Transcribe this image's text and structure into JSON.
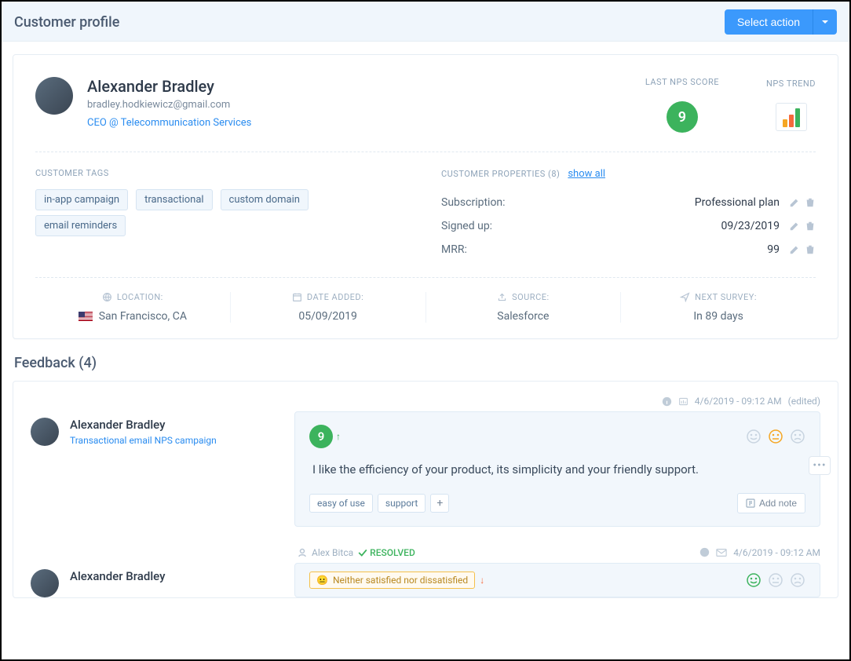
{
  "header": {
    "title": "Customer profile",
    "actionLabel": "Select action"
  },
  "profile": {
    "name": "Alexander Bradley",
    "email": "bradley.hodkiewicz@gmail.com",
    "role": "CEO @ Telecommunication Services",
    "npsLabel": "LAST NPS SCORE",
    "npsScore": "9",
    "trendLabel": "NPS TREND"
  },
  "tags": {
    "label": "CUSTOMER TAGS",
    "items": [
      "in-app campaign",
      "transactional",
      "custom domain",
      "email reminders"
    ]
  },
  "properties": {
    "label": "CUSTOMER PROPERTIES (8)",
    "showAll": "show all",
    "rows": [
      {
        "key": "Subscription:",
        "val": "Professional plan"
      },
      {
        "key": "Signed up:",
        "val": "09/23/2019"
      },
      {
        "key": "MRR:",
        "val": "99"
      }
    ]
  },
  "meta": {
    "location": {
      "label": "LOCATION:",
      "val": "San Francisco, CA"
    },
    "dateAdded": {
      "label": "DATE ADDED:",
      "val": "05/09/2019"
    },
    "source": {
      "label": "SOURCE:",
      "val": "Salesforce"
    },
    "nextSurvey": {
      "label": "NEXT SURVEY:",
      "val": "In 89 days"
    }
  },
  "feedback": {
    "heading": "Feedback (4)",
    "item1": {
      "timestamp": "4/6/2019 - 09:12 AM",
      "edited": "(edited)",
      "name": "Alexander Bradley",
      "campaign": "Transactional email NPS campaign",
      "score": "9",
      "text": "I like the efficiency of your product, its simplicity and your friendly support.",
      "tags": [
        "easy of use",
        "support"
      ],
      "addNote": "Add note"
    },
    "status": {
      "assignee": "Alex Bitca",
      "state": "RESOLVED",
      "timestamp": "4/6/2019 - 09:12 AM"
    },
    "item2": {
      "name": "Alexander Bradley",
      "satisfaction": "Neither satisfied nor dissatisfied"
    }
  }
}
